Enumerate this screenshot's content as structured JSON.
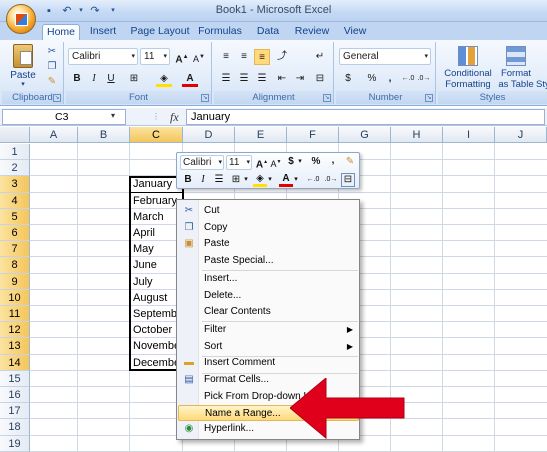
{
  "window": {
    "title": "Book1 - Microsoft Excel"
  },
  "tabs": [
    "Home",
    "Insert",
    "Page Layout",
    "Formulas",
    "Data",
    "Review",
    "View"
  ],
  "ribbon": {
    "clipboard": {
      "paste": "Paste",
      "label": "Clipboard"
    },
    "font": {
      "name": "Calibri",
      "size": "11",
      "bold": "B",
      "italic": "I",
      "underline": "U",
      "label": "Font"
    },
    "alignment": {
      "label": "Alignment"
    },
    "number": {
      "format": "General",
      "currency": "$",
      "percent": "%",
      "comma": ",",
      "label": "Number"
    },
    "styles": {
      "conditional_l1": "Conditional",
      "conditional_l2": "Formatting",
      "format_table_l1": "Format",
      "format_table_l2": "as Table",
      "cell_styles": "Sty",
      "label": "Styles"
    }
  },
  "formula_bar": {
    "name_box": "C3",
    "fx": "fx",
    "value": "January"
  },
  "columns": [
    "A",
    "B",
    "C",
    "D",
    "E",
    "F",
    "G",
    "H",
    "I",
    "J"
  ],
  "rows": [
    "1",
    "2",
    "3",
    "4",
    "5",
    "6",
    "7",
    "8",
    "9",
    "10",
    "11",
    "12",
    "13",
    "14",
    "15",
    "16",
    "17",
    "18",
    "19"
  ],
  "cells_c": [
    "January",
    "February",
    "March",
    "April",
    "May",
    "June",
    "July",
    "August",
    "September",
    "October",
    "November",
    "December"
  ],
  "mini_toolbar": {
    "font": "Calibri",
    "size": "11",
    "currency": "$",
    "percent": "%",
    "comma": ",",
    "bold": "B",
    "italic": "I",
    "font_color": "A"
  },
  "context_menu": {
    "cut": "Cut",
    "copy": "Copy",
    "paste": "Paste",
    "paste_special": "Paste Special...",
    "insert": "Insert...",
    "delete": "Delete...",
    "clear_contents": "Clear Contents",
    "filter": "Filter",
    "sort": "Sort",
    "insert_comment": "Insert Comment",
    "format_cells": "Format Cells...",
    "pick_list": "Pick From Drop-down List...",
    "name_range": "Name a Range...",
    "hyperlink": "Hyperlink..."
  },
  "colors": {
    "highlight_arrow": "#e0001b",
    "selection_header": "#f4c65c"
  }
}
